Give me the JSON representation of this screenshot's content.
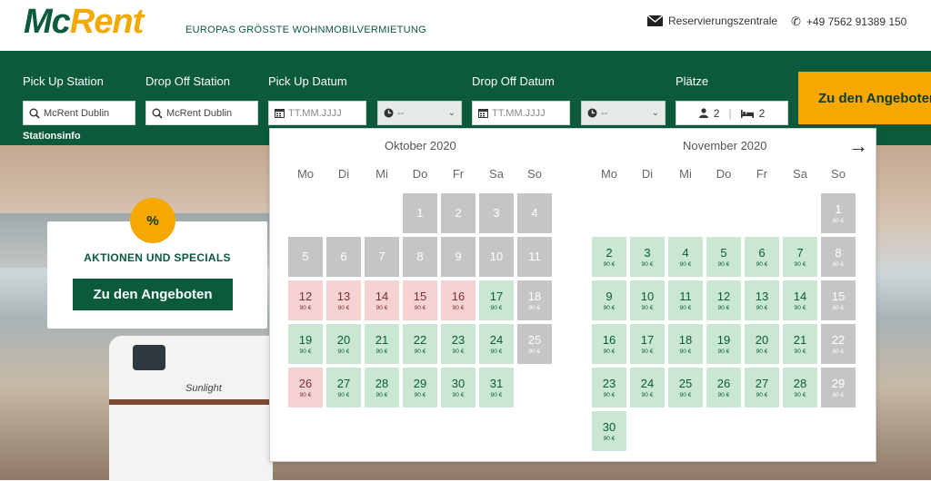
{
  "header": {
    "logo_part1": "Mc",
    "logo_part2": "Rent",
    "tagline": "EUROPAS GRÖSSTE WOHNMOBILVERMIETUNG",
    "mail_label": "Reservierungszentrale",
    "phone_label": "+49 7562 91389 150"
  },
  "search": {
    "pickup_station_label": "Pick Up Station",
    "pickup_station_value": "McRent Dublin",
    "dropoff_station_label": "Drop Off Station",
    "dropoff_station_value": "McRent Dublin",
    "pickup_date_label": "Pick Up Datum",
    "pickup_date_placeholder": "TT.MM.JJJJ",
    "pickup_time_value": "--",
    "dropoff_date_label": "Drop Off Datum",
    "dropoff_date_placeholder": "TT.MM.JJJJ",
    "dropoff_time_value": "--",
    "seats_label": "Plätze",
    "seats_persons": "2",
    "seats_separator": "|",
    "seats_beds": "2",
    "stationinfo": "Stationsinfo",
    "cta": "Zu den Angeboten"
  },
  "promo": {
    "badge": "%",
    "title": "AKTIONEN UND SPECIALS",
    "button": "Zu den Angeboten"
  },
  "hero": {
    "rv_brand": "Sunlight"
  },
  "calendar": {
    "weekdays": [
      "Mo",
      "Di",
      "Mi",
      "Do",
      "Fr",
      "Sa",
      "So"
    ],
    "months": [
      {
        "title": "Oktober 2020",
        "offset": 3,
        "days": [
          {
            "d": "1",
            "s": "gray",
            "p": ""
          },
          {
            "d": "2",
            "s": "gray",
            "p": ""
          },
          {
            "d": "3",
            "s": "gray",
            "p": ""
          },
          {
            "d": "4",
            "s": "gray",
            "p": ""
          },
          {
            "d": "5",
            "s": "gray",
            "p": ""
          },
          {
            "d": "6",
            "s": "gray",
            "p": ""
          },
          {
            "d": "7",
            "s": "gray",
            "p": ""
          },
          {
            "d": "8",
            "s": "gray",
            "p": ""
          },
          {
            "d": "9",
            "s": "gray",
            "p": ""
          },
          {
            "d": "10",
            "s": "gray",
            "p": ""
          },
          {
            "d": "11",
            "s": "gray",
            "p": ""
          },
          {
            "d": "12",
            "s": "pink",
            "p": "90 €"
          },
          {
            "d": "13",
            "s": "pink",
            "p": "90 €"
          },
          {
            "d": "14",
            "s": "pink",
            "p": "90 €"
          },
          {
            "d": "15",
            "s": "pink",
            "p": "90 €"
          },
          {
            "d": "16",
            "s": "pink",
            "p": "90 €"
          },
          {
            "d": "17",
            "s": "green",
            "p": "90 €"
          },
          {
            "d": "18",
            "s": "gray",
            "p": "90 €"
          },
          {
            "d": "19",
            "s": "green",
            "p": "90 €"
          },
          {
            "d": "20",
            "s": "green",
            "p": "90 €"
          },
          {
            "d": "21",
            "s": "green",
            "p": "90 €"
          },
          {
            "d": "22",
            "s": "green",
            "p": "90 €"
          },
          {
            "d": "23",
            "s": "green",
            "p": "90 €"
          },
          {
            "d": "24",
            "s": "green",
            "p": "90 €"
          },
          {
            "d": "25",
            "s": "gray",
            "p": "90 €"
          },
          {
            "d": "26",
            "s": "pink",
            "p": "90 €"
          },
          {
            "d": "27",
            "s": "green",
            "p": "90 €"
          },
          {
            "d": "28",
            "s": "green",
            "p": "90 €"
          },
          {
            "d": "29",
            "s": "green",
            "p": "90 €"
          },
          {
            "d": "30",
            "s": "green",
            "p": "90 €"
          },
          {
            "d": "31",
            "s": "green",
            "p": "90 €"
          }
        ]
      },
      {
        "title": "November 2020",
        "offset": 6,
        "days": [
          {
            "d": "1",
            "s": "gray",
            "p": "90 €"
          },
          {
            "d": "2",
            "s": "green",
            "p": "90 €"
          },
          {
            "d": "3",
            "s": "green",
            "p": "90 €"
          },
          {
            "d": "4",
            "s": "green",
            "p": "90 €"
          },
          {
            "d": "5",
            "s": "green",
            "p": "90 €"
          },
          {
            "d": "6",
            "s": "green",
            "p": "90 €"
          },
          {
            "d": "7",
            "s": "green",
            "p": "90 €"
          },
          {
            "d": "8",
            "s": "gray",
            "p": "90 €"
          },
          {
            "d": "9",
            "s": "green",
            "p": "90 €"
          },
          {
            "d": "10",
            "s": "green",
            "p": "90 €"
          },
          {
            "d": "11",
            "s": "green",
            "p": "90 €"
          },
          {
            "d": "12",
            "s": "green",
            "p": "90 €"
          },
          {
            "d": "13",
            "s": "green",
            "p": "90 €"
          },
          {
            "d": "14",
            "s": "green",
            "p": "90 €"
          },
          {
            "d": "15",
            "s": "gray",
            "p": "90 €"
          },
          {
            "d": "16",
            "s": "green",
            "p": "90 €"
          },
          {
            "d": "17",
            "s": "green",
            "p": "90 €"
          },
          {
            "d": "18",
            "s": "green",
            "p": "90 €"
          },
          {
            "d": "19",
            "s": "green",
            "p": "90 €"
          },
          {
            "d": "20",
            "s": "green",
            "p": "90 €"
          },
          {
            "d": "21",
            "s": "green",
            "p": "90 €"
          },
          {
            "d": "22",
            "s": "gray",
            "p": "90 €"
          },
          {
            "d": "23",
            "s": "green",
            "p": "90 €"
          },
          {
            "d": "24",
            "s": "green",
            "p": "90 €"
          },
          {
            "d": "25",
            "s": "green",
            "p": "90 €"
          },
          {
            "d": "26",
            "s": "green",
            "p": "90 €"
          },
          {
            "d": "27",
            "s": "green",
            "p": "90 €"
          },
          {
            "d": "28",
            "s": "green",
            "p": "90 €"
          },
          {
            "d": "29",
            "s": "gray",
            "p": "90 €"
          },
          {
            "d": "30",
            "s": "green",
            "p": "90 €"
          }
        ]
      }
    ]
  },
  "colors": {
    "brand_green": "#0b5a3c",
    "brand_yellow": "#f6a700",
    "available": "#c9e7d2",
    "unavailable": "#c5c5c5",
    "special": "#f6d2d2"
  }
}
